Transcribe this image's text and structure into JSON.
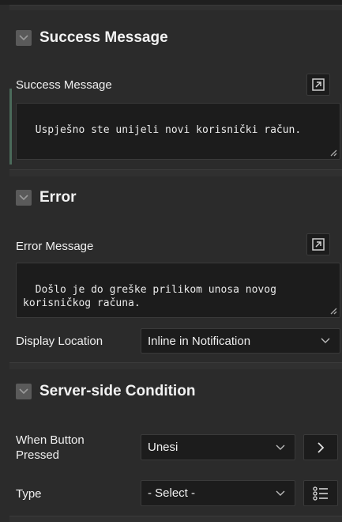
{
  "success_section": {
    "title": "Success Message",
    "field_label": "Success Message",
    "value": "Uspješno ste unijeli novi korisnički račun."
  },
  "error_section": {
    "title": "Error",
    "field_label": "Error Message",
    "value": "Došlo je do greške prilikom unosa novog\nkorisničkog računa.",
    "display_location_label": "Display Location",
    "display_location_value": "Inline in Notification"
  },
  "condition_section": {
    "title": "Server-side Condition",
    "when_button_label": "When Button\nPressed",
    "when_button_value": "Unesi",
    "type_label": "Type",
    "type_value": "- Select -"
  },
  "icons": {
    "chevron": "chevron-down-icon",
    "expand": "expand-icon",
    "next": "chevron-right-icon",
    "list": "list-icon"
  }
}
